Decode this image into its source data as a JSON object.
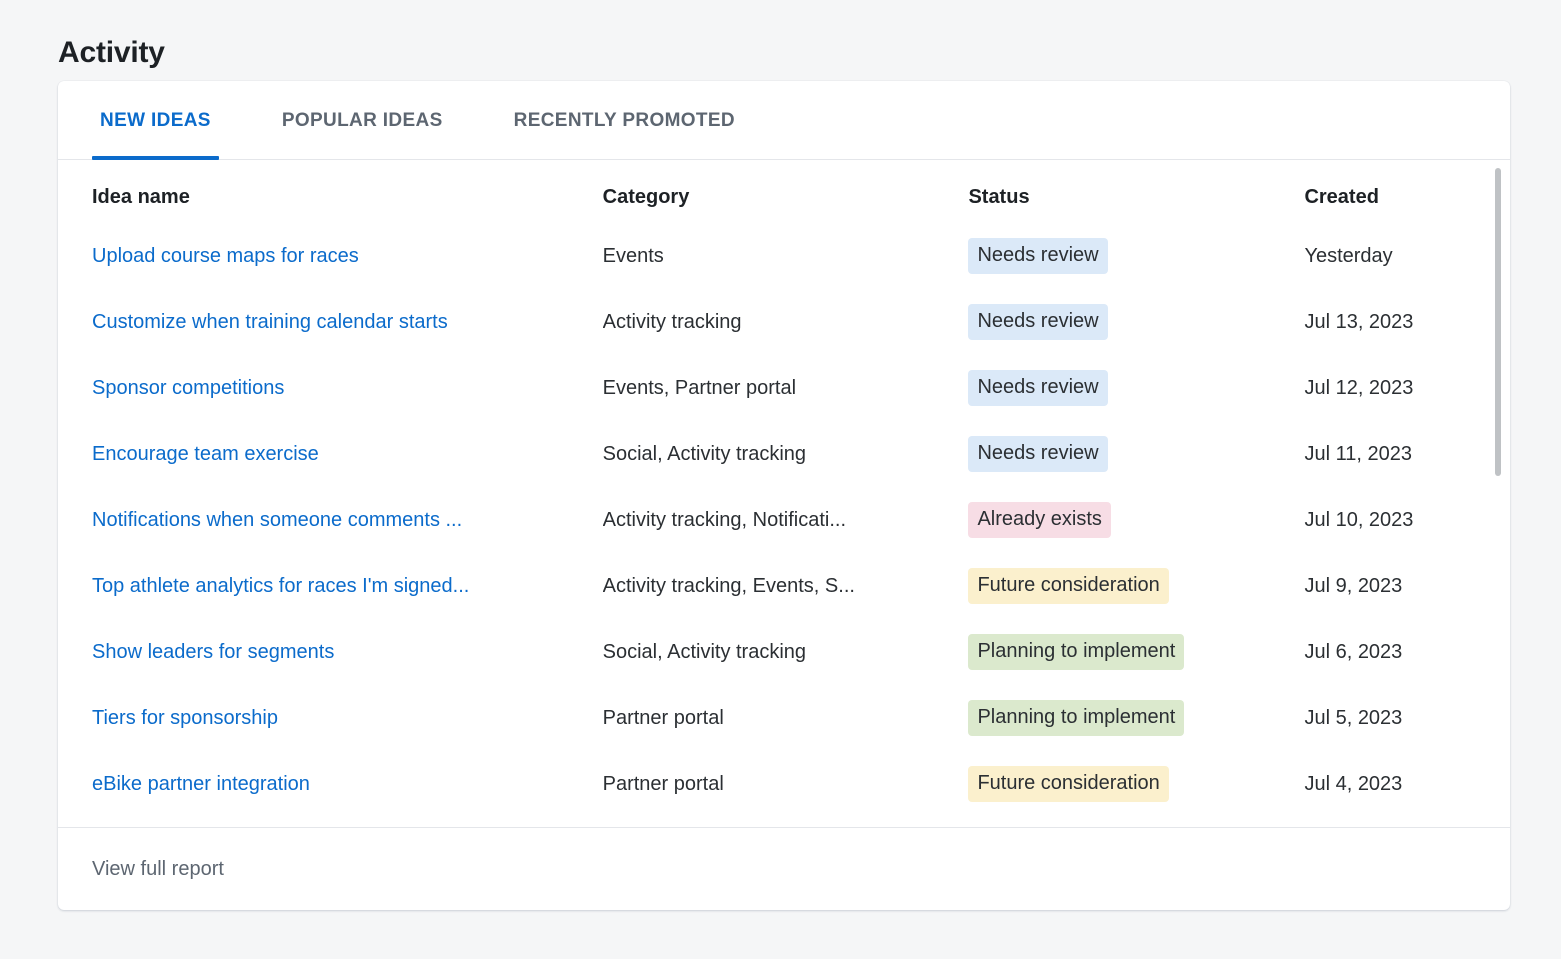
{
  "page": {
    "title": "Activity"
  },
  "tabs": [
    {
      "label": "NEW IDEAS",
      "active": true
    },
    {
      "label": "POPULAR IDEAS",
      "active": false
    },
    {
      "label": "RECENTLY PROMOTED",
      "active": false
    }
  ],
  "table": {
    "columns": [
      "Idea name",
      "Category",
      "Status",
      "Created"
    ],
    "rows": [
      {
        "name": "Upload course maps for races",
        "category": "Events",
        "status": "Needs review",
        "status_color": "#dbe9f8",
        "created": "Yesterday"
      },
      {
        "name": "Customize when training calendar starts",
        "category": "Activity tracking",
        "status": "Needs review",
        "status_color": "#dbe9f8",
        "created": "Jul 13, 2023"
      },
      {
        "name": "Sponsor competitions",
        "category": "Events, Partner portal",
        "status": "Needs review",
        "status_color": "#dbe9f8",
        "created": "Jul 12, 2023"
      },
      {
        "name": "Encourage team exercise",
        "category": "Social, Activity tracking",
        "status": "Needs review",
        "status_color": "#dbe9f8",
        "created": "Jul 11, 2023"
      },
      {
        "name": "Notifications when someone comments ...",
        "category": "Activity tracking, Notificati...",
        "status": "Already exists",
        "status_color": "#f7dde5",
        "created": "Jul 10, 2023"
      },
      {
        "name": "Top athlete analytics for races I'm signed...",
        "category": "Activity tracking, Events, S...",
        "status": "Future consideration",
        "status_color": "#fbf0cd",
        "created": "Jul 9, 2023"
      },
      {
        "name": "Show leaders for segments",
        "category": "Social, Activity tracking",
        "status": "Planning to implement",
        "status_color": "#dbe9cd",
        "created": "Jul 6, 2023"
      },
      {
        "name": "Tiers for sponsorship",
        "category": "Partner portal",
        "status": "Planning to implement",
        "status_color": "#dbe9cd",
        "created": "Jul 5, 2023"
      },
      {
        "name": "eBike partner integration",
        "category": "Partner portal",
        "status": "Future consideration",
        "status_color": "#fbf0cd",
        "created": "Jul 4, 2023"
      }
    ]
  },
  "footer": {
    "link_label": "View full report"
  },
  "colors": {
    "accent": "#0b6bcb",
    "link": "#0b6bcb",
    "page_background": "#f5f6f7",
    "card_background": "#ffffff",
    "text": "#2b2f33",
    "muted_text": "#5d6671",
    "scrollbar_thumb": "#bfc2c5"
  }
}
